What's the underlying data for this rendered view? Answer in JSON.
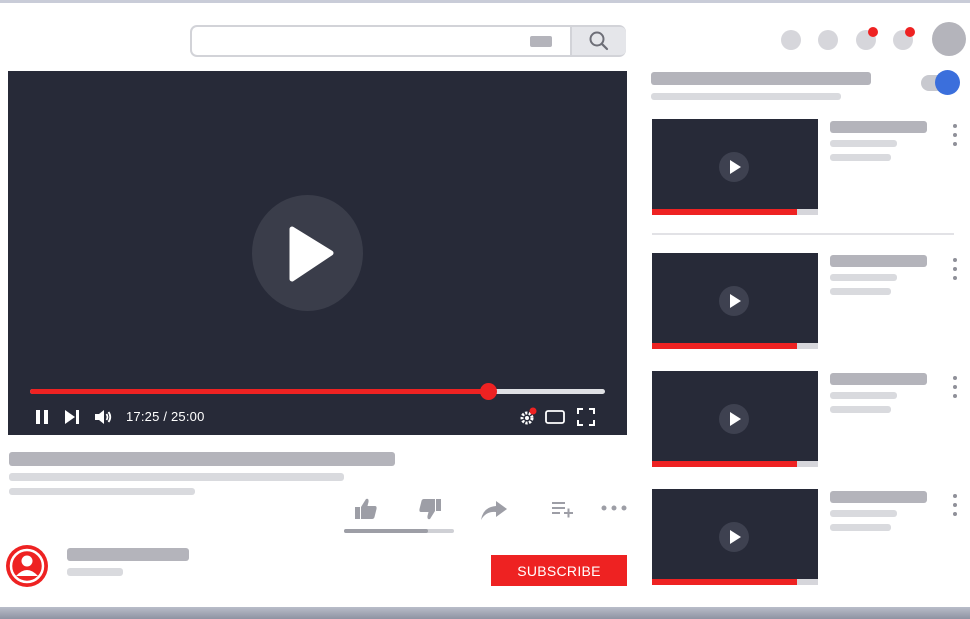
{
  "player": {
    "time_display": "17:25 / 25:00",
    "progress_fraction": 0.797,
    "state": "paused"
  },
  "channel": {
    "subscribe_label": "SUBSCRIBE"
  },
  "icons": {
    "search": "search-icon",
    "pause": "pause-icon",
    "next": "skip-next-icon",
    "volume": "volume-icon",
    "settings": "settings-gear-icon",
    "miniplayer": "miniplayer-icon",
    "fullscreen": "fullscreen-icon",
    "like": "thumbs-up-icon",
    "dislike": "thumbs-down-icon",
    "share": "share-icon",
    "save": "add-to-playlist-icon",
    "more": "more-horizontal-icon",
    "item_menu": "more-vertical-icon"
  },
  "sidebar": {
    "autoplay_on": true,
    "videos": [
      {
        "watched_fraction": 0.875
      },
      {
        "watched_fraction": 0.875
      },
      {
        "watched_fraction": 0.875
      },
      {
        "watched_fraction": 0.875
      }
    ]
  },
  "colors": {
    "accent_red": "#ee2222",
    "player_bg": "#272a38",
    "toggle_blue": "#3b6fdc",
    "placeholder_gray": "#b4b4bb"
  }
}
